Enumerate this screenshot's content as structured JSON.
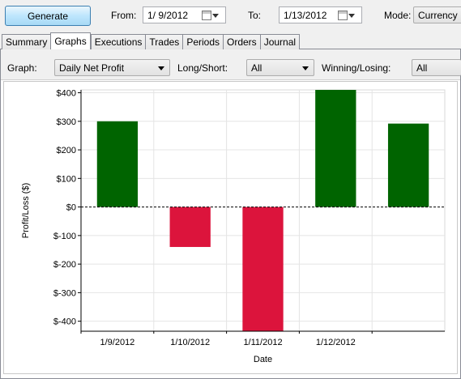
{
  "toolbar": {
    "generate_label": "Generate",
    "from_label": "From:",
    "from_value": "1/  9/2012",
    "to_label": "To:",
    "to_value": "1/13/2012",
    "mode_label": "Mode:",
    "mode_value": "Currency"
  },
  "tabs": [
    {
      "label": "Summary",
      "active": false
    },
    {
      "label": "Graphs",
      "active": true
    },
    {
      "label": "Executions",
      "active": false
    },
    {
      "label": "Trades",
      "active": false
    },
    {
      "label": "Periods",
      "active": false
    },
    {
      "label": "Orders",
      "active": false
    },
    {
      "label": "Journal",
      "active": false
    }
  ],
  "filters": {
    "graph_label": "Graph:",
    "graph_value": "Daily Net Profit",
    "long_short_label": "Long/Short:",
    "long_short_value": "All",
    "win_lose_label": "Winning/Losing:",
    "win_lose_value": "All"
  },
  "colors": {
    "positive": "#006400",
    "negative": "#dc143c"
  },
  "chart_data": {
    "type": "bar",
    "categories": [
      "1/9/2012",
      "1/10/2012",
      "1/11/2012",
      "1/12/2012",
      ""
    ],
    "values": [
      300,
      -140,
      -435,
      410,
      292
    ],
    "xlabel": "Date",
    "ylabel": "Profit/Loss ($)",
    "ylim": [
      -435,
      410
    ],
    "yticks": [
      400,
      300,
      200,
      100,
      0,
      -100,
      -200,
      -300,
      -400
    ],
    "ytick_labels": [
      "$400",
      "$300",
      "$200",
      "$100",
      "$0",
      "$-100",
      "$-200",
      "$-300",
      "$-400"
    ],
    "zero_line": "dashed",
    "grid": true
  }
}
